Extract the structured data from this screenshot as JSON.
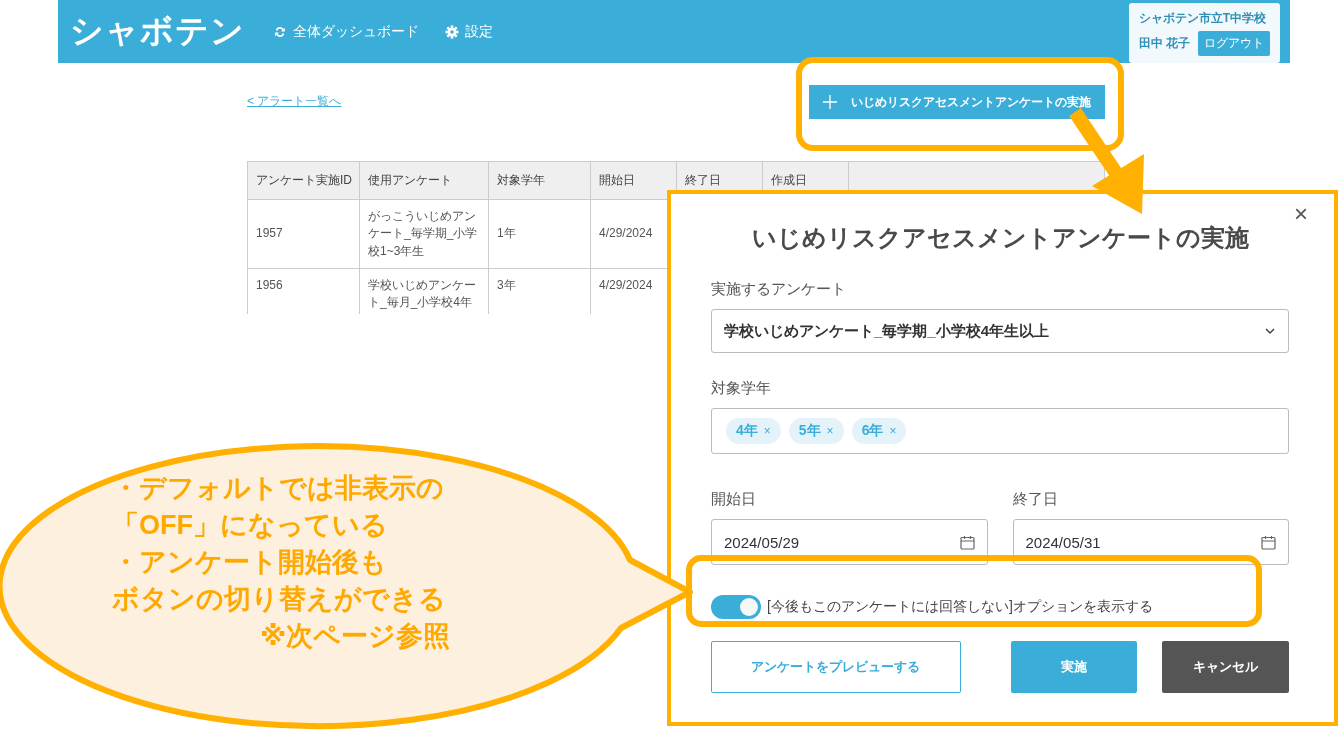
{
  "header": {
    "logo": "シャボテン",
    "nav": [
      {
        "label": "全体ダッシュボード"
      },
      {
        "label": "設定"
      }
    ],
    "user": {
      "school": "シャボテン市立T中学校",
      "name": "田中 花子",
      "logout": "ログアウト"
    }
  },
  "back_link": "< アラート一覧へ",
  "action_button": {
    "label": "いじめリスクアセスメントアンケートの実施"
  },
  "table": {
    "columns": [
      "アンケート実施ID",
      "使用アンケート",
      "対象学年",
      "開始日",
      "終了日",
      "作成日"
    ],
    "rows": [
      {
        "cells": [
          "1957",
          "がっこういじめアンケート_毎学期_小学校1~3年生",
          "1年",
          "4/29/2024"
        ]
      },
      {
        "cells": [
          "1956",
          "学校いじめアンケート_毎月_小学校4年",
          "3年",
          "4/29/2024"
        ]
      }
    ]
  },
  "dialog": {
    "close": "×",
    "title": "いじめリスクアセスメントアンケートの実施",
    "survey_label": "実施するアンケート",
    "survey_value": "学校いじめアンケート_毎学期_小学校4年生以上",
    "grade_label": "対象学年",
    "grades": [
      {
        "label": "4年",
        "remove": "×"
      },
      {
        "label": "5年",
        "remove": "×"
      },
      {
        "label": "6年",
        "remove": "×"
      }
    ],
    "start_label": "開始日",
    "start_value": "2024/05/29",
    "end_label": "終了日",
    "end_value": "2024/05/31",
    "toggle": {
      "on": true,
      "label": "[今後もこのアンケートには回答しない]オプションを表示する"
    },
    "buttons": [
      {
        "label": "アンケートをプレビューする",
        "kind": "outline"
      },
      {
        "label": "実施",
        "kind": "primary"
      },
      {
        "label": "キャンセル",
        "kind": "dark"
      }
    ]
  },
  "callout": {
    "lines": [
      "・デフォルトでは非表示の",
      "「OFF」になっている",
      "・アンケート開始後も",
      "ボタンの切り替えができる",
      "※次ページ参照"
    ]
  }
}
